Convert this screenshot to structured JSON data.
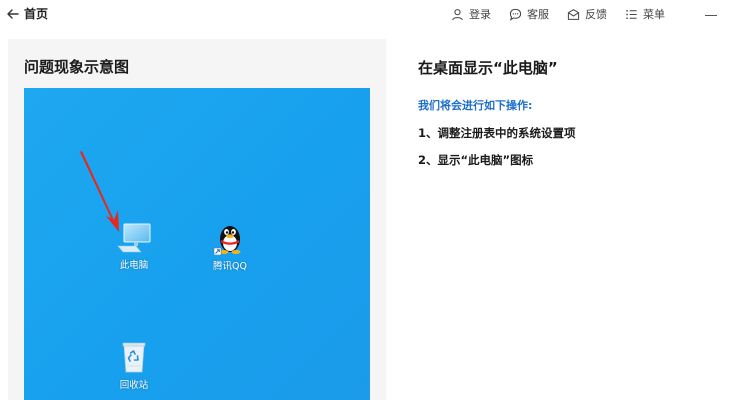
{
  "topbar": {
    "back_label": "首页",
    "actions": [
      {
        "label": "登录",
        "icon": "user-icon"
      },
      {
        "label": "客服",
        "icon": "chat-icon"
      },
      {
        "label": "反馈",
        "icon": "feedback-icon"
      },
      {
        "label": "菜单",
        "icon": "menu-icon"
      }
    ]
  },
  "left": {
    "title": "问题现象示意图",
    "desktop_icons": [
      {
        "label": "此电脑",
        "icon": "computer-icon"
      },
      {
        "label": "腾讯QQ",
        "icon": "qq-penguin-icon"
      },
      {
        "label": "回收站",
        "icon": "recycle-bin-icon"
      }
    ]
  },
  "right": {
    "title": "在桌面显示“此电脑”",
    "intro": "我们将会进行如下操作:",
    "steps": [
      "1、调整注册表中的系统设置项",
      "2、显示“此电脑”图标"
    ]
  },
  "colors": {
    "desktop_bg": "#17a0ee",
    "intro_text": "#1e6fc9",
    "panel_bg": "#f5f5f6",
    "arrow": "#e8271f"
  }
}
